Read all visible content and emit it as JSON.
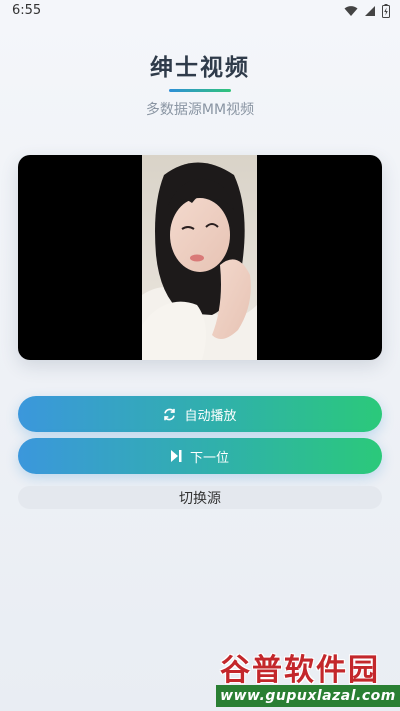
{
  "status_bar": {
    "time": "6:55"
  },
  "header": {
    "title": "绅士视频",
    "subtitle": "多数据源MM视频"
  },
  "colors": {
    "accent_start": "#3b97dc",
    "accent_end": "#2bc97a",
    "title": "#2f3b4a"
  },
  "buttons": {
    "auto_play": {
      "label": "自动播放",
      "icon": "refresh-icon"
    },
    "next": {
      "label": "下一位",
      "icon": "skip-next-icon"
    },
    "switch_source": {
      "label": "切换源"
    }
  },
  "watermark": {
    "line1": "谷普软件园",
    "line2": "www.gupuxlazal.com"
  }
}
